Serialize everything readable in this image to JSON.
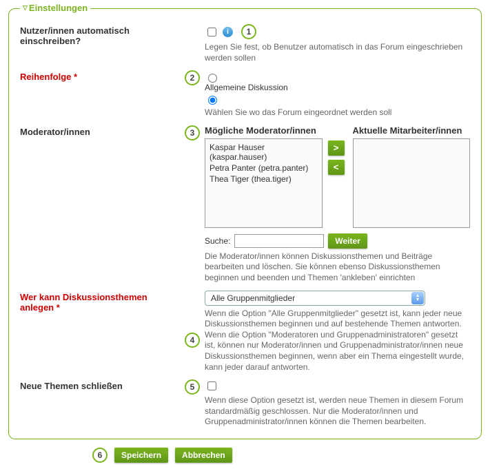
{
  "legend": "Einstellungen",
  "rows": {
    "autoEnroll": {
      "label": "Nutzer/innen automatisch einschreiben?",
      "desc": "Legen Sie fest, ob Benutzer automatisch in das Forum eingeschrieben werden sollen"
    },
    "order": {
      "label": "Reihenfolge *",
      "option1": "Allgemeine Diskussion",
      "desc": "Wählen Sie wo das Forum eingeordnet werden soll"
    },
    "moderators": {
      "label": "Moderator/innen",
      "possibleHeader": "Mögliche Moderator/innen",
      "currentHeader": "Aktuelle Mitarbeiter/innen",
      "possibleList": [
        "Kaspar Hauser (kaspar.hauser)",
        "Petra Panter (petra.panter)",
        "Thea Tiger (thea.tiger)"
      ],
      "searchLabel": "Suche:",
      "searchBtn": "Weiter",
      "desc": "Die Moderator/innen können Diskussionsthemen und Beiträge bearbeiten und löschen. Sie können ebenso Diskussionsthemen beginnen und beenden und Themen 'ankleben' einrichten"
    },
    "whoCanCreate": {
      "label": "Wer kann Diskussionsthemen anlegen *",
      "selected": "Alle Gruppenmitglieder",
      "desc": "Wenn die Option \"Alle Gruppenmitglieder\" gesetzt ist, kann jeder neue Diskussionsthemen beginnen und auf bestehende Themen antworten. Wenn die Option \"Moderatoren und Gruppenadministratoren\" gesetzt ist, können nur Moderator/innen und Gruppenadministrator/innen neue Diskussionsthemen beginnen, wenn aber ein Thema eingestellt wurde, kann jeder darauf antworten."
    },
    "closeNew": {
      "label": "Neue Themen schließen",
      "desc": "Wenn diese Option gesetzt ist, werden neue Themen in diesem Forum standardmäßig geschlossen. Nur die Moderator/innen und Gruppenadministrator/innen können die Themen bearbeiten."
    }
  },
  "badges": {
    "b1": "1",
    "b2": "2",
    "b3": "3",
    "b4": "4",
    "b5": "5",
    "b6": "6"
  },
  "buttons": {
    "moveRight": ">",
    "moveLeft": "<",
    "save": "Speichern",
    "cancel": "Abbrechen"
  }
}
